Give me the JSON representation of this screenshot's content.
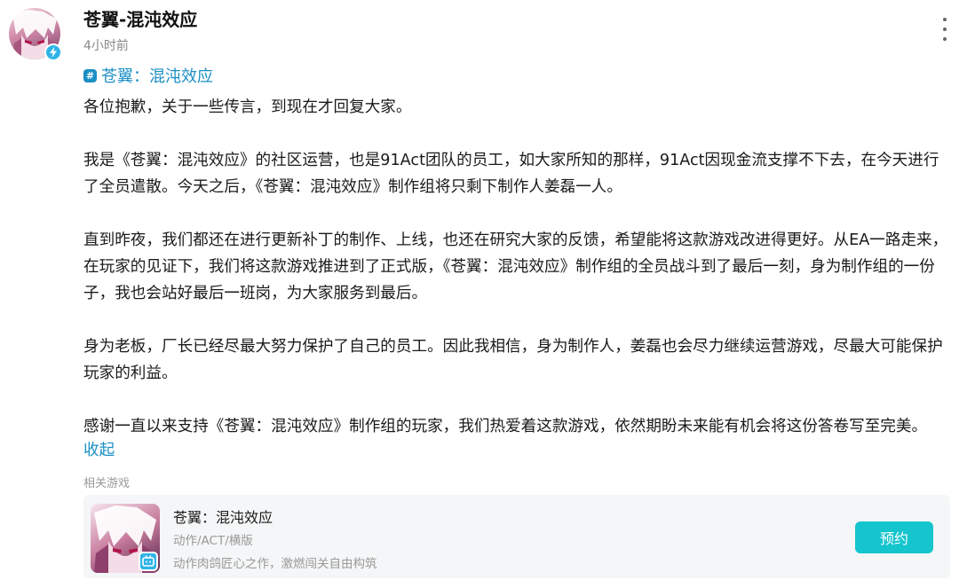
{
  "author": {
    "name": "苍翼-混沌效应",
    "time": "4小时前"
  },
  "topic": {
    "label": "苍翼：混沌效应"
  },
  "post": {
    "paragraphs": [
      "各位抱歉，关于一些传言，到现在才回复大家。",
      "我是《苍翼：混沌效应》的社区运营，也是91Act团队的员工，如大家所知的那样，91Act因现金流支撑不下去，在今天进行了全员遣散。今天之后，《苍翼：混沌效应》制作组将只剩下制作人姜磊一人。",
      "直到昨夜，我们都还在进行更新补丁的制作、上线，也还在研究大家的反馈，希望能将这款游戏改进得更好。从EA一路走来，在玩家的见证下，我们将这款游戏推进到了正式版，《苍翼：混沌效应》制作组的全员战斗到了最后一刻，身为制作组的一份子，我也会站好最后一班岗，为大家服务到最后。",
      "身为老板，厂长已经尽最大努力保护了自己的员工。因此我相信，身为制作人，姜磊也会尽力继续运营游戏，尽最大可能保护玩家的利益。",
      "感谢一直以来支持《苍翼：混沌效应》制作组的玩家，我们热爱着这款游戏，依然期盼未来能有机会将这份答卷写至完美。"
    ],
    "collapse_label": "收起"
  },
  "related": {
    "label": "相关游戏",
    "game": {
      "title": "苍翼：混沌效应",
      "genre": "动作/ACT/横版",
      "description": "动作肉鸽匠心之作，激燃闯关自由构筑",
      "button_label": "预约"
    }
  },
  "colors": {
    "accent": "#1b8fc4",
    "button": "#15c5ce",
    "verified": "#2fb4e8"
  }
}
